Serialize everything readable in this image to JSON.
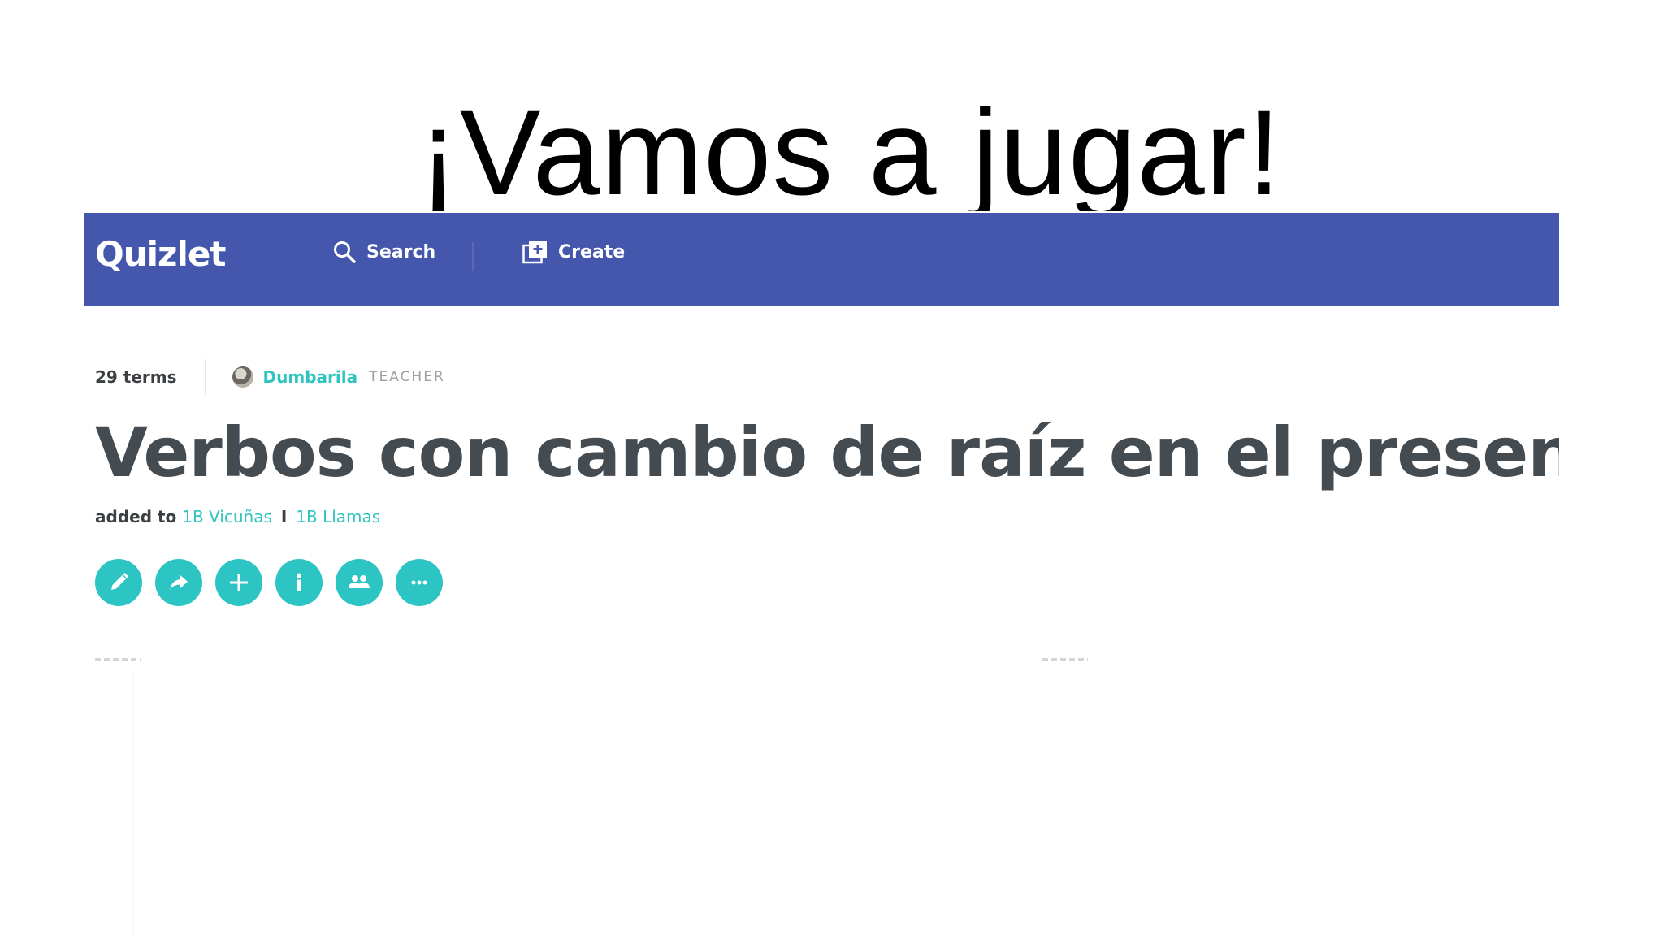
{
  "slide": {
    "title": "¡Vamos a jugar!"
  },
  "navbar": {
    "logo": "Quizlet",
    "search_label": "Search",
    "create_label": "Create",
    "background_color": "#4556ad"
  },
  "set": {
    "terms_count": "29 terms",
    "author": "Dumbarila",
    "author_role": "TEACHER",
    "title": "Verbos con cambio de raíz en el presente",
    "added_to_label": "added to",
    "classes": [
      "1B Vicuñas",
      "1B Llamas"
    ],
    "class_separator": "I"
  },
  "actions": [
    {
      "icon": "pencil-icon"
    },
    {
      "icon": "share-icon"
    },
    {
      "icon": "plus-icon"
    },
    {
      "icon": "info-icon"
    },
    {
      "icon": "people-icon"
    },
    {
      "icon": "more-icon"
    }
  ],
  "accent_color": "#2cc5c4"
}
